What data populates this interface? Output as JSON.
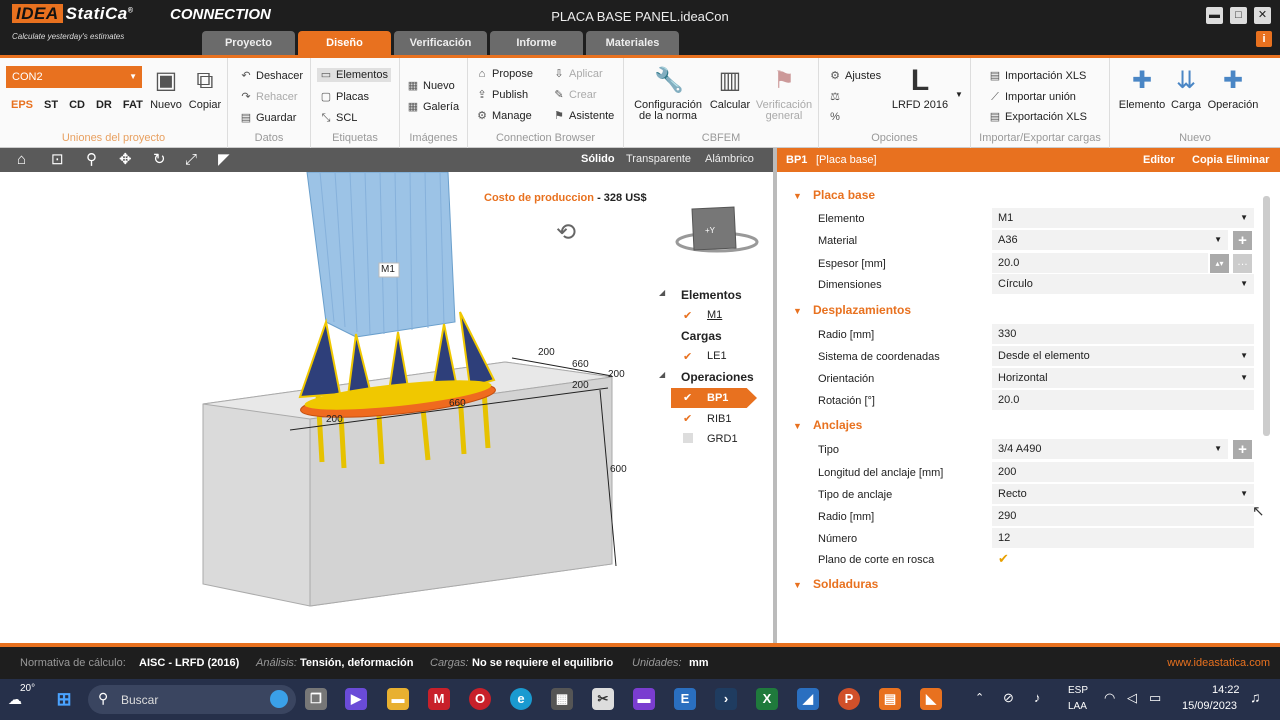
{
  "app": {
    "brand": "IDEA",
    "brand2": "StatiCa",
    "trademark": "®",
    "tagline": "Calculate yesterday's estimates",
    "product": "CONNECTION",
    "title": "PLACA BASE PANEL.ideaCon",
    "minimize": "▬",
    "maximize": "□",
    "close": "✕",
    "info": "i"
  },
  "tabs": [
    "Proyecto",
    "Diseño",
    "Verificación",
    "Informe",
    "Materiales"
  ],
  "ribbon": {
    "project": {
      "connection": "CON2",
      "types": [
        "EPS",
        "ST",
        "CD",
        "DR",
        "FAT"
      ],
      "new": "Nuevo",
      "copy": "Copiar",
      "title": "Uniones del proyecto"
    },
    "data": {
      "undo": "Deshacer",
      "redo": "Rehacer",
      "save": "Guardar",
      "title": "Datos"
    },
    "labels": {
      "elements": "Elementos",
      "plates": "Placas",
      "scl": "SCL",
      "title": "Etiquetas"
    },
    "images": {
      "new": "Nuevo",
      "gallery": "Galería",
      "title": "Imágenes"
    },
    "browser": {
      "propose": "Propose",
      "publish": "Publish",
      "manage": "Manage",
      "apply": "Aplicar",
      "create": "Crear",
      "assistant": "Asistente",
      "title": "Connection Browser"
    },
    "cbfem": {
      "config1": "Configuración",
      "config2": "de la norma",
      "calc": "Calcular",
      "verif1": "Verificación",
      "verif2": "general",
      "title": "CBFEM"
    },
    "options": {
      "settings": "Ajustes",
      "code": "LRFD 2016",
      "title": "Opciones"
    },
    "io": {
      "importxls": "Importación XLS",
      "importjoint": "Importar unión",
      "exportxls": "Exportación XLS",
      "title": "Importar/Exportar cargas"
    },
    "new": {
      "element": "Elemento",
      "load": "Carga",
      "operation": "Operación",
      "title": "Nuevo"
    }
  },
  "view": {
    "modes": [
      "Sólido",
      "Transparente",
      "Alámbrico"
    ],
    "cost_label": "Costo de produccion",
    "cost_sep": "-",
    "cost_value": "328 US$",
    "member": "M1",
    "cube": "+Y",
    "dims": {
      "d200a": "200",
      "d660a": "660",
      "d200b": "200",
      "d200c": "200",
      "d660b": "660",
      "d200d": "200",
      "d600": "600"
    },
    "tree": {
      "elements": "Elementos",
      "m1": "M1",
      "loads": "Cargas",
      "le1": "LE1",
      "ops": "Operaciones",
      "bp1": "BP1",
      "rib1": "RIB1",
      "grd1": "GRD1"
    }
  },
  "props": {
    "header_id": "BP1",
    "header_name": "[Placa base]",
    "editor": "Editor",
    "copy": "Copia",
    "delete": "Eliminar",
    "s1": "Placa base",
    "s2": "Desplazamientos",
    "s3": "Anclajes",
    "s4": "Soldaduras",
    "rows": [
      {
        "label": "Elemento",
        "value": "M1"
      },
      {
        "label": "Material",
        "value": "A36"
      },
      {
        "label": "Espesor [mm]",
        "value": "20.0"
      },
      {
        "label": "Dimensiones",
        "value": "Círculo"
      },
      {
        "label": "Radio [mm]",
        "value": "330"
      },
      {
        "label": "Sistema de coordenadas",
        "value": "Desde el elemento"
      },
      {
        "label": "Orientación",
        "value": "Horizontal"
      },
      {
        "label": "Rotación [°]",
        "value": "20.0"
      },
      {
        "label": "Tipo",
        "value": "3/4 A490"
      },
      {
        "label": "Longitud del anclaje [mm]",
        "value": "200"
      },
      {
        "label": "Tipo de anclaje",
        "value": "Recto"
      },
      {
        "label": "Radio [mm]",
        "value": "290"
      },
      {
        "label": "Número",
        "value": "12"
      },
      {
        "label": "Plano de corte en rosca",
        "value": "✔"
      }
    ]
  },
  "status": {
    "code_label": "Normativa de cálculo:",
    "code": "AISC - LRFD (2016)",
    "analysis_label": "Análisis:",
    "analysis": "Tensión, deformación",
    "loads_label": "Cargas:",
    "loads": "No se requiere el equilibrio",
    "units_label": "Unidades:",
    "units": "mm",
    "url": "www.ideastatica.com"
  },
  "taskbar": {
    "temp": "20°",
    "search": "Buscar",
    "lang1": "ESP",
    "lang2": "LAA",
    "time": "14:22",
    "date": "15/09/2023"
  }
}
